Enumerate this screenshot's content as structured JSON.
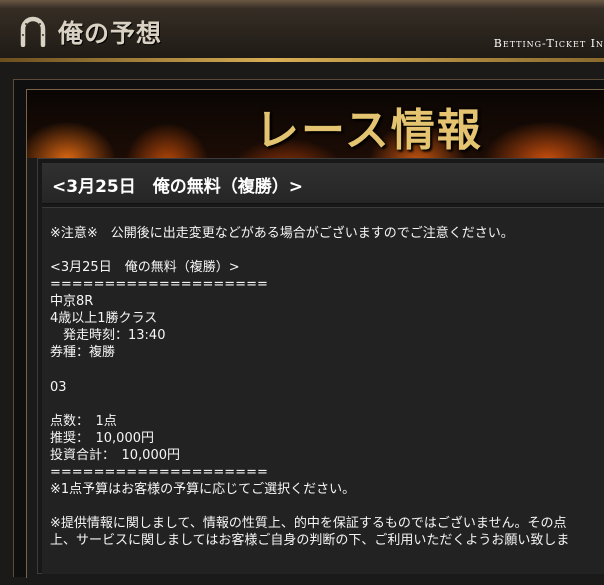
{
  "header": {
    "site_title": "俺の予想",
    "subtitle": "Betting-Ticket In"
  },
  "banner": {
    "title": "レース情報"
  },
  "race": {
    "heading": "<3月25日　俺の無料（複勝）>",
    "lines": [
      "※注意※　公開後に出走変更などがある場合がございますのでご注意ください。",
      "<3月25日　俺の無料（複勝）>",
      "====================",
      "中京8R",
      "4歳以上1勝クラス",
      "　発走時刻：13:40",
      "券種：複勝",
      "03",
      "点数：　1点",
      "推奨：　10,000円",
      "投資合計：　10,000円",
      "====================",
      "※1点予算はお客様の予算に応じてご選択ください。",
      "※提供情報に関しまして、情報の性質上、的中を保証するものではございません。その点",
      "上、サービスに関しましてはお客様ご自身の判断の下、ご利用いただくようお願い致しま"
    ]
  }
}
